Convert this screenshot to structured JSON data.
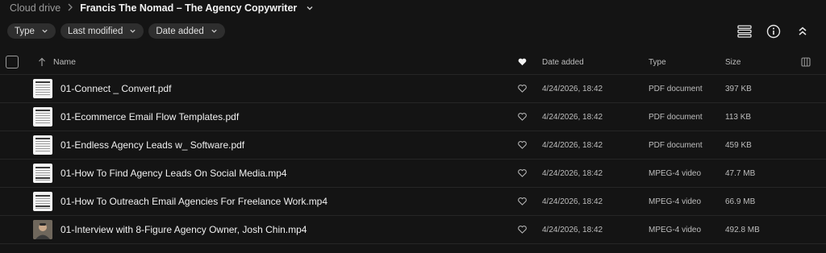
{
  "breadcrumb": {
    "root": "Cloud drive",
    "separator": ">",
    "current": "Francis The Nomad – The Agency Copywriter"
  },
  "filters": [
    {
      "label": "Type"
    },
    {
      "label": "Last modified"
    },
    {
      "label": "Date added"
    }
  ],
  "toolbar": {
    "list_icon": "list-view-icon",
    "info_icon": "info-icon",
    "collapse_icon": "collapse-icon"
  },
  "table": {
    "headers": {
      "name": "Name",
      "date_added": "Date added",
      "type": "Type",
      "size": "Size"
    },
    "rows": [
      {
        "name": "01-Connect _ Convert.pdf",
        "date": "4/24/2026, 18:42",
        "type": "PDF document",
        "size": "397 KB",
        "thumb": "document"
      },
      {
        "name": "01-Ecommerce Email Flow Templates.pdf",
        "date": "4/24/2026, 18:42",
        "type": "PDF document",
        "size": "113 KB",
        "thumb": "document"
      },
      {
        "name": "01-Endless Agency Leads w_ Software.pdf",
        "date": "4/24/2026, 18:42",
        "type": "PDF document",
        "size": "459 KB",
        "thumb": "document"
      },
      {
        "name": "01-How To Find Agency Leads On Social Media.mp4",
        "date": "4/24/2026, 18:42",
        "type": "MPEG-4 video",
        "size": "47.7 MB",
        "thumb": "video-doc"
      },
      {
        "name": "01-How To Outreach Email Agencies For Freelance Work.mp4",
        "date": "4/24/2026, 18:42",
        "type": "MPEG-4 video",
        "size": "66.9 MB",
        "thumb": "video-doc"
      },
      {
        "name": "01-Interview with 8-Figure Agency Owner, Josh Chin.mp4",
        "date": "4/24/2026, 18:42",
        "type": "MPEG-4 video",
        "size": "492.8 MB",
        "thumb": "photo"
      }
    ]
  },
  "colors": {
    "background": "#141414",
    "chip": "#2e2e2e",
    "text": "#f0f0f0",
    "muted": "#bdbdbd"
  }
}
